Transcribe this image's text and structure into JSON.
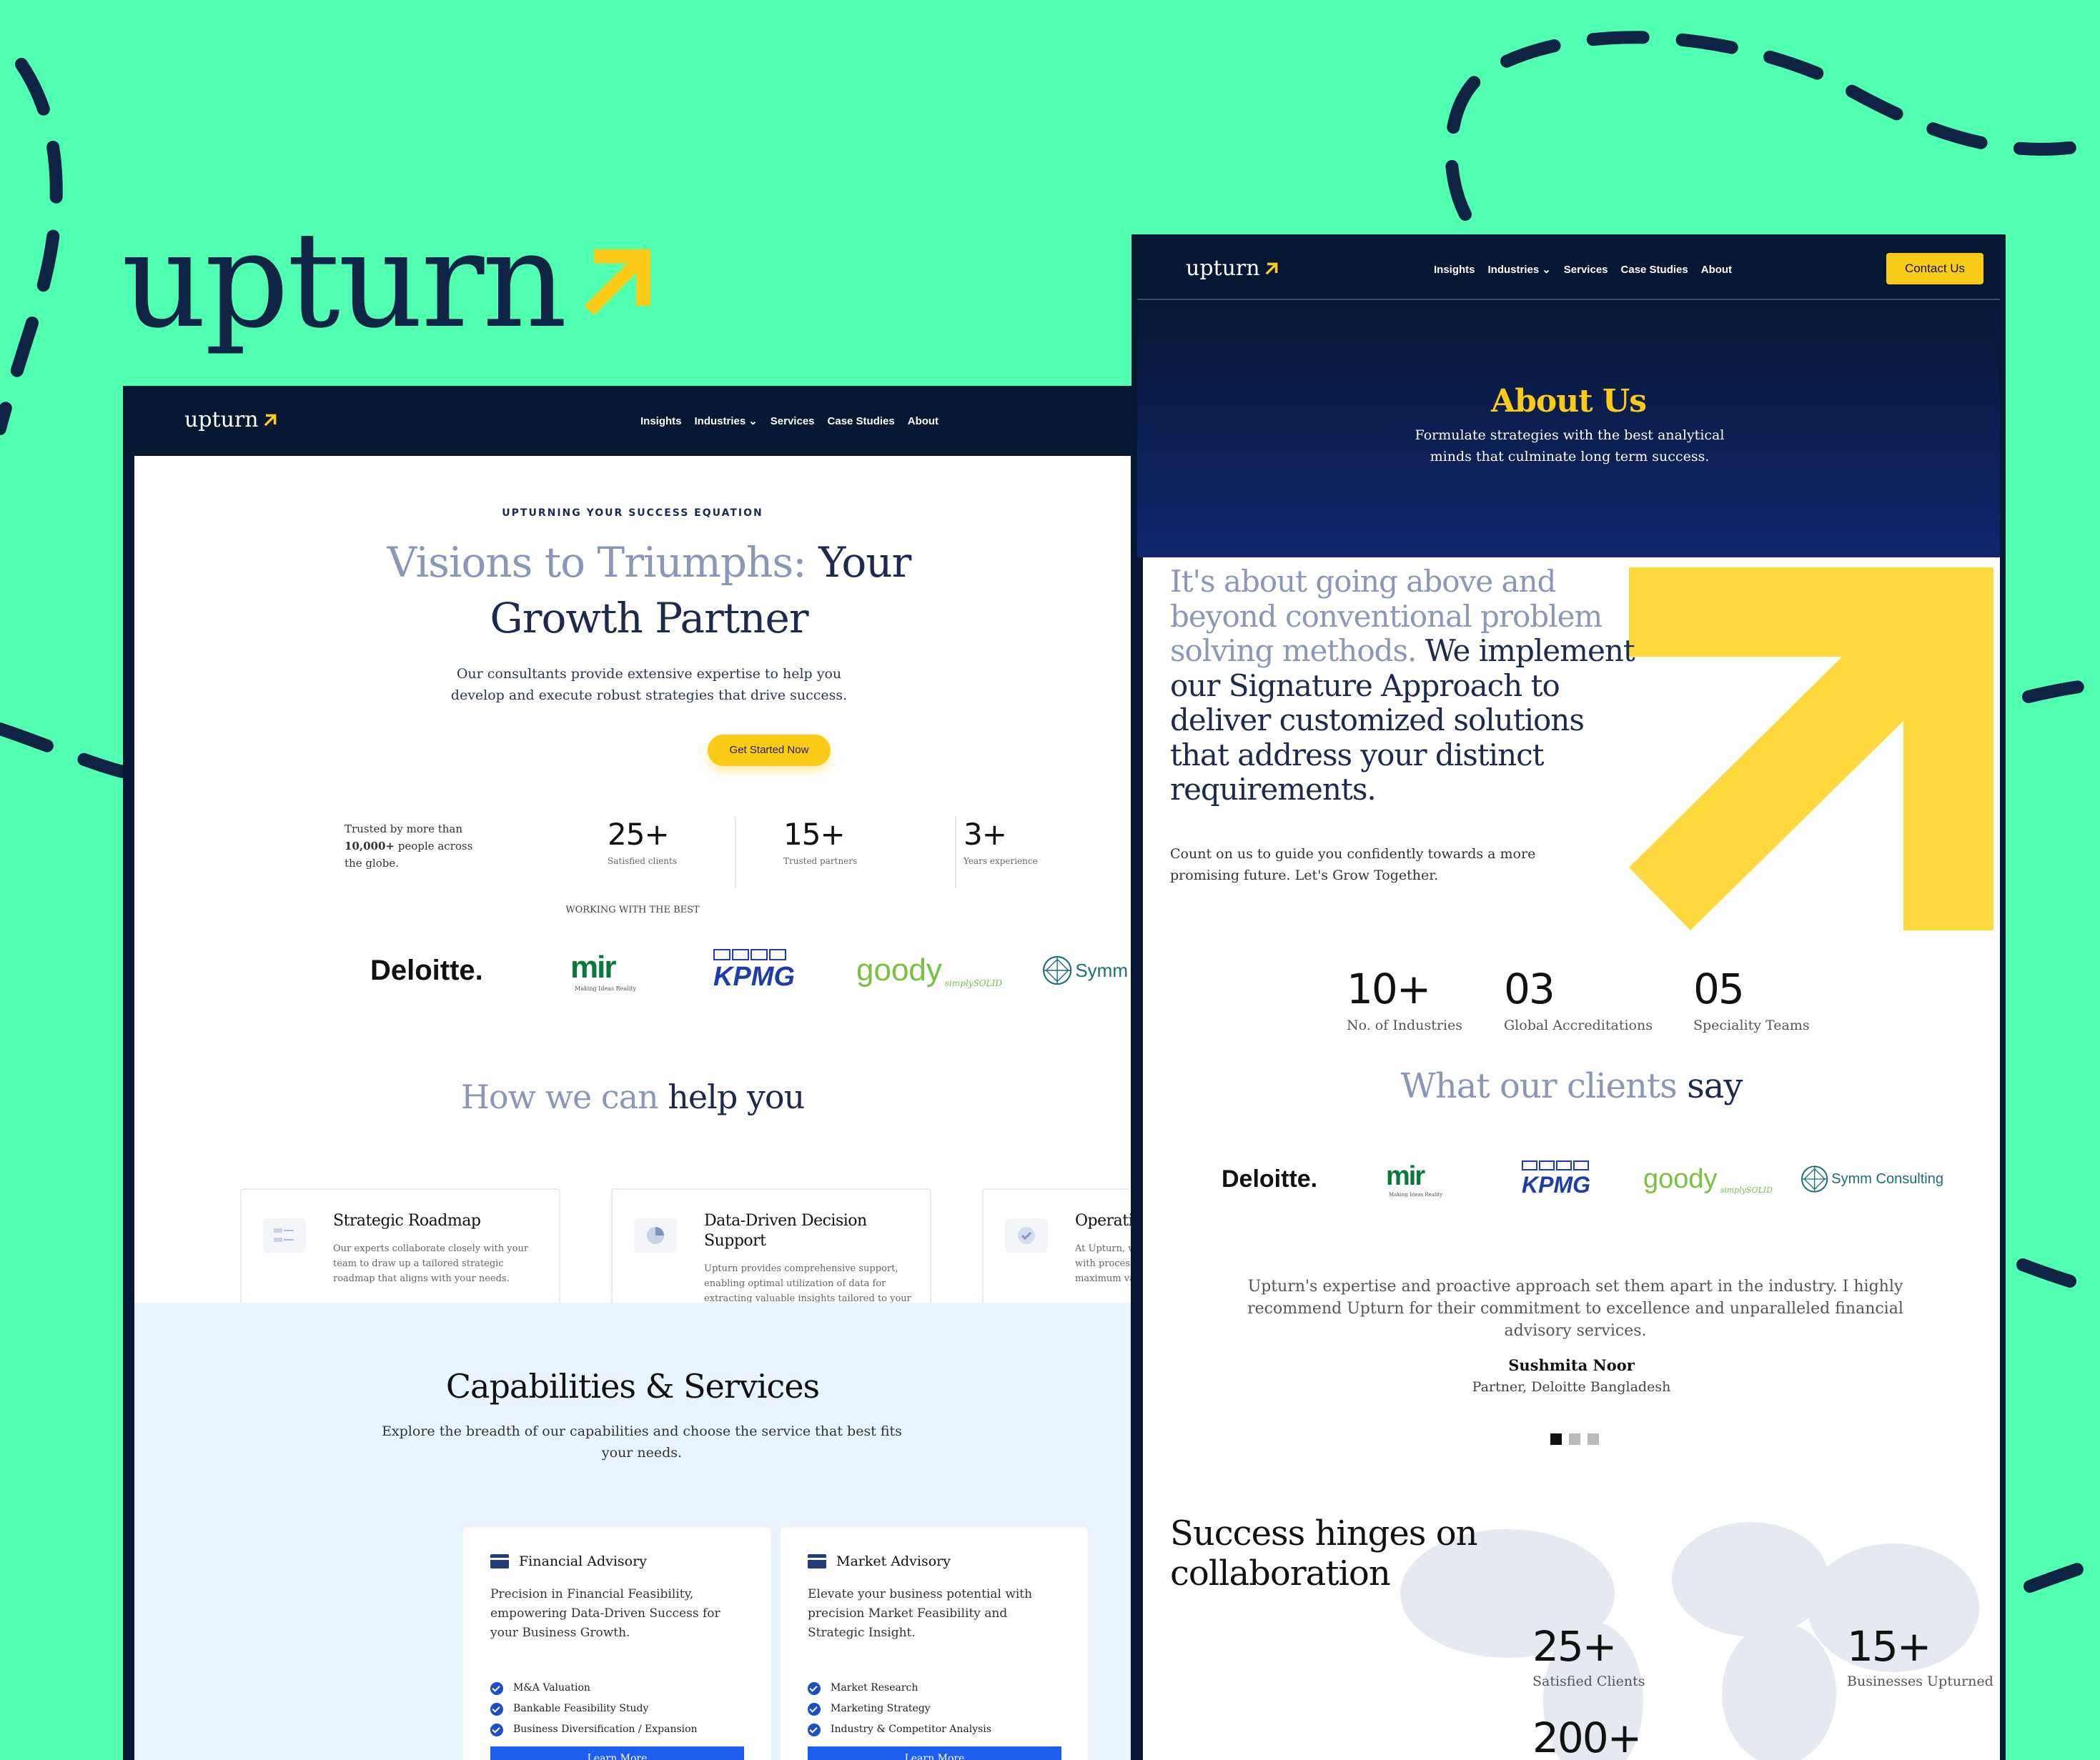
{
  "brand": {
    "wordmark": "upturn",
    "accent_color": "#fccb18",
    "bg_color": "#51ffb1",
    "navy": "#061733"
  },
  "left_page": {
    "nav": {
      "logo": "upturn",
      "links": [
        "Insights",
        "Industries",
        "Services",
        "Case Studies",
        "About"
      ],
      "dropdown_icon": "chevron-down-icon"
    },
    "hero": {
      "eyebrow": "UPTURNING YOUR SUCCESS EQUATION",
      "title_soft": "Visions to Triumphs:",
      "title_main_1": " Your",
      "title_main_2": "Growth Partner",
      "subtitle": "Our consultants provide extensive expertise to help you develop and execute robust strategies that drive success.",
      "cta": "Get Started Now"
    },
    "trust": {
      "prefix": "Trusted by more than",
      "bold": "10,000+",
      "suffix": "people across the globe."
    },
    "stats": [
      {
        "num": "25+",
        "label": "Satisfied clients"
      },
      {
        "num": "15+",
        "label": "Trusted partners"
      },
      {
        "num": "3+",
        "label": "Years experience"
      }
    ],
    "working_with": "WORKING WITH THE BEST",
    "logos": [
      "Deloitte.",
      "mir",
      "KPMG",
      "goody",
      "Symm"
    ],
    "logo_tags": {
      "mir": "Making Ideas Reality",
      "goody": "simplySOLID"
    },
    "help": {
      "soft": "How we can",
      "main": " help you"
    },
    "help_cards": [
      {
        "title": "Strategic Roadmap",
        "desc": "Our experts collaborate closely with your team to draw up a tailored strategic roadmap that aligns with your needs.",
        "icon": "roadmap-icon"
      },
      {
        "title": "Data-Driven Decision Support",
        "desc": "Upturn provides comprehensive support, enabling optimal utilization of data for extracting valuable insights tailored to your requirements.",
        "icon": "pie-chart-icon"
      },
      {
        "title": "Operatio",
        "desc": "At Upturn, we with process maximum va",
        "icon": "check-shield-icon"
      }
    ],
    "capabilities": {
      "title": "Capabilities & Services",
      "subtitle": "Explore the breadth of our capabilities and choose the service that best fits your needs.",
      "services": [
        {
          "title": "Financial Advisory",
          "desc": "Precision in Financial Feasibility, empowering Data-Driven Success for your Business Growth.",
          "items": [
            "M&A Valuation",
            "Bankable Feasibility Study",
            "Business Diversification / Expansion"
          ],
          "button": "Learn More"
        },
        {
          "title": "Market Advisory",
          "desc": "Elevate your business potential with precision Market Feasibility and Strategic Insight.",
          "items": [
            "Market Research",
            "Marketing Strategy",
            "Industry & Competitor Analysis"
          ],
          "button": "Learn More"
        }
      ]
    }
  },
  "right_page": {
    "nav": {
      "logo": "upturn",
      "links": [
        "Insights",
        "Industries",
        "Services",
        "Case Studies",
        "About"
      ],
      "contact": "Contact Us"
    },
    "hero": {
      "title": "About Us",
      "subtitle": "Formulate strategies with the best analytical minds that culminate long term success."
    },
    "intro": {
      "soft": "It's about going above and beyond conventional problem solving methods.",
      "main": " We implement our Signature Approach to deliver customized solutions that address your distinct requirements.",
      "sub": "Count on us to guide you confidently towards a more promising future. Let's Grow Together."
    },
    "stats": [
      {
        "num": "10+",
        "label": "No. of Industries"
      },
      {
        "num": "03",
        "label": "Global Accreditations"
      },
      {
        "num": "05",
        "label": "Speciality Teams"
      }
    ],
    "clients": {
      "soft": "What our clients",
      "main": " say"
    },
    "logos": [
      "Deloitte.",
      "mir",
      "KPMG",
      "goody",
      "Symm Consulting"
    ],
    "testimonial": {
      "quote": "Upturn's expertise and proactive approach set them apart in the industry. I highly recommend Upturn for their commitment to excellence and unparalleled financial advisory services.",
      "name": "Sushmita Noor",
      "role": "Partner, Deloitte Bangladesh"
    },
    "success": {
      "title": "Success hinges on collaboration",
      "stats": [
        {
          "num": "25+",
          "label": "Satisfied Clients"
        },
        {
          "num": "15+",
          "label": "Businesses Upturned"
        },
        {
          "num": "200+",
          "label": ""
        }
      ]
    }
  }
}
